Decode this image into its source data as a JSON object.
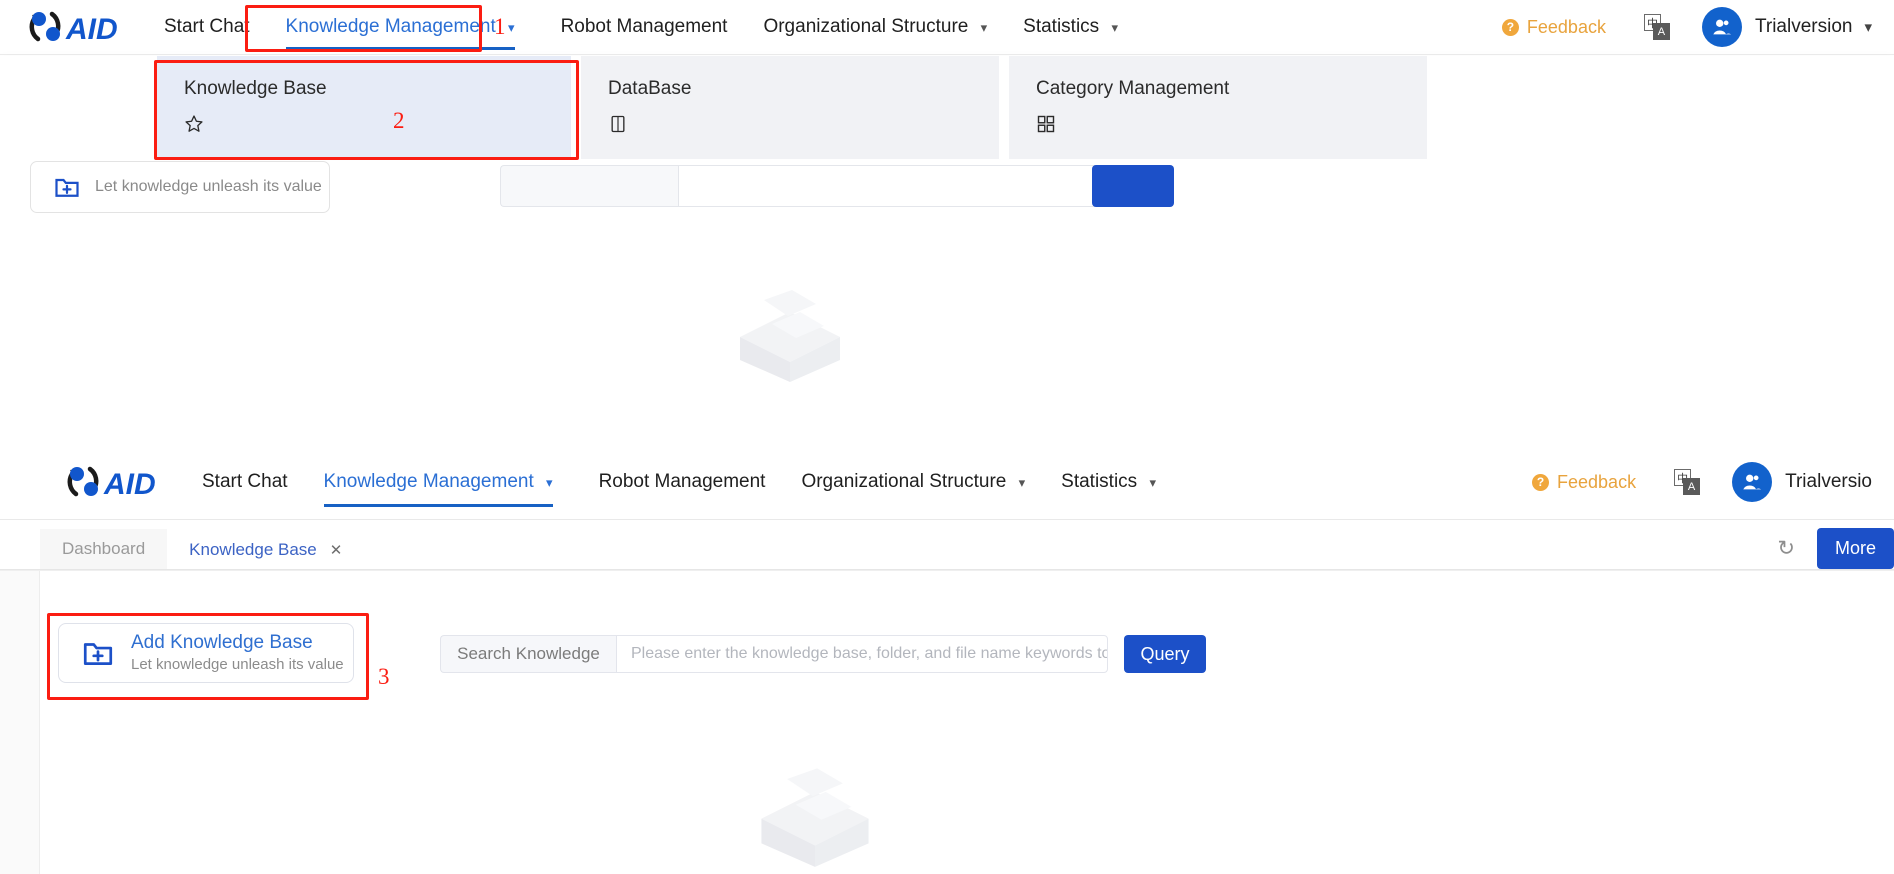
{
  "brand": {
    "name": "AID",
    "logo_icon": "aid-logo"
  },
  "top_nav": {
    "items": [
      {
        "label": "Start Chat",
        "has_caret": false,
        "active": false
      },
      {
        "label": "Knowledge Management",
        "has_caret": true,
        "active": true
      },
      {
        "label": "Robot Management",
        "has_caret": false,
        "active": false
      },
      {
        "label": "Organizational Structure",
        "has_caret": true,
        "active": false
      },
      {
        "label": "Statistics",
        "has_caret": true,
        "active": false
      }
    ],
    "feedback_label": "Feedback",
    "feedback_icon": "question-circle-icon",
    "language_icon": "language-switch-icon",
    "language_zh": "中",
    "language_en": "A",
    "avatar_icon": "user-avatar-icon",
    "user_name": "Trialversion",
    "user_caret": "∨"
  },
  "mega_menu": {
    "items": [
      {
        "label": "Knowledge Base",
        "icon": "star-icon",
        "glyph": "☆",
        "selected": true
      },
      {
        "label": "DataBase",
        "icon": "book-icon",
        "glyph": "Ὅ6",
        "selected": false
      },
      {
        "label": "Category Management",
        "icon": "grid-icon",
        "glyph": "grid",
        "selected": false
      }
    ]
  },
  "annotations": [
    {
      "number": "1",
      "target": "knowledge-management-nav-item"
    },
    {
      "number": "2",
      "target": "knowledge-base-mega-card"
    },
    {
      "number": "3",
      "target": "add-knowledge-base-card"
    }
  ],
  "background_page": {
    "card_sub": "Let knowledge unleash its value",
    "card_icon": "add-folder-icon"
  },
  "inner_window": {
    "nav": {
      "items": [
        {
          "label": "Start Chat",
          "has_caret": false,
          "active": false
        },
        {
          "label": "Knowledge Management",
          "has_caret": true,
          "active": true
        },
        {
          "label": "Robot Management",
          "has_caret": false,
          "active": false
        },
        {
          "label": "Organizational Structure",
          "has_caret": true,
          "active": false
        },
        {
          "label": "Statistics",
          "has_caret": true,
          "active": false
        }
      ],
      "feedback_label": "Feedback",
      "user_name": "Trialversio"
    },
    "tabs": [
      {
        "label": "Dashboard",
        "active": false,
        "closable": false
      },
      {
        "label": "Knowledge Base",
        "active": true,
        "closable": true,
        "close_glyph": "✕"
      }
    ],
    "tab_actions": {
      "refresh_icon": "refresh-icon",
      "refresh_glyph": "↻",
      "more_label": "More"
    },
    "add_card": {
      "title": "Add Knowledge Base",
      "subtitle": "Let knowledge unleash its value",
      "icon": "add-folder-icon"
    },
    "search": {
      "label": "Search Knowledge",
      "placeholder": "Please enter the knowledge base, folder, and file name keywords to",
      "query_label": "Query"
    }
  },
  "colors": {
    "accent_blue": "#1c50c8",
    "link_blue": "#2f6fd0",
    "annotation_red": "#fb1d12",
    "feedback_orange": "#e8a33d",
    "mega_selected_bg": "#e6ebf7",
    "mega_bg": "#f1f2f5"
  }
}
